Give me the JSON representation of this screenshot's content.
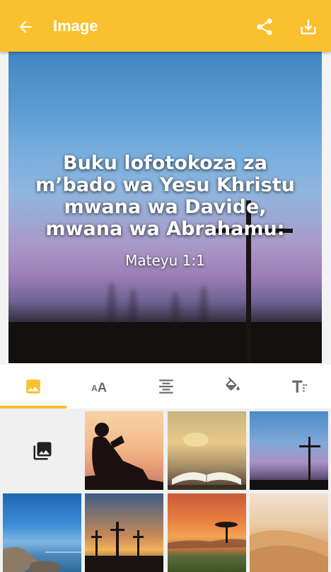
{
  "app_bar": {
    "title": "Image",
    "back_icon": "arrow-left-icon",
    "share_icon": "share-icon",
    "download_icon": "download-icon",
    "accent_color": "#fbc02d"
  },
  "preview": {
    "verse_lines": [
      "Buku lofotokoza za",
      "m’bado wa Yesu Khristu",
      "mwana wa Davide,",
      "mwana wa Abrahamu:"
    ],
    "reference": "Mateyu 1:1"
  },
  "tabs": [
    {
      "icon": "image-icon",
      "selected": true
    },
    {
      "icon": "font-size-icon",
      "selected": false
    },
    {
      "icon": "align-center-icon",
      "selected": false
    },
    {
      "icon": "fill-color-icon",
      "selected": false
    },
    {
      "icon": "text-format-icon",
      "selected": false
    }
  ],
  "background_grid": {
    "gallery_icon": "photo-library-icon",
    "thumbnails": [
      "boy-reading-silhouette",
      "open-bible-sunset",
      "cross-at-dusk",
      "lake-shore-blue-sky",
      "three-crosses-sunset",
      "savanna-tree-sunset",
      "desert-dunes"
    ]
  }
}
